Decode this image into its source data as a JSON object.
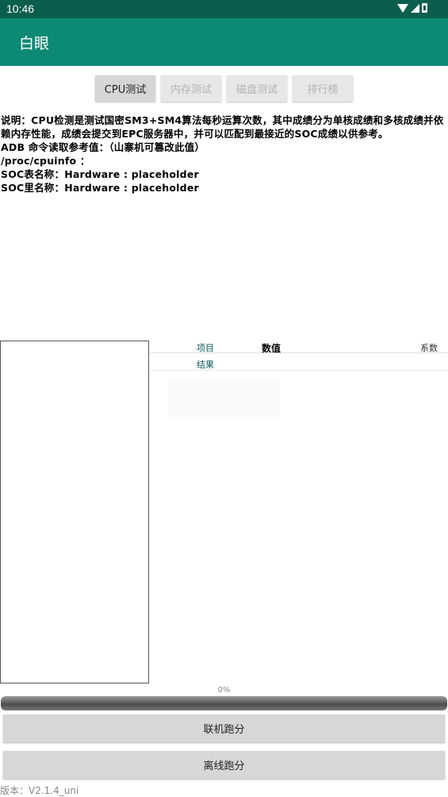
{
  "status_bar": {
    "time": "10:46"
  },
  "app_bar": {
    "title": "白眼"
  },
  "tabs": [
    {
      "label": "CPU测试",
      "active": true
    },
    {
      "label": "内存测试",
      "active": false
    },
    {
      "label": "磁盘测试",
      "active": false
    },
    {
      "label": "排行榜",
      "active": false
    }
  ],
  "description": {
    "intro": "说明：CPU检测是测试国密SM3+SM4算法每秒运算次数，其中成绩分为单核成绩和多核成绩并依赖内存性能，成绩会提交到EPC服务器中，并可以匹配到最接近的SOC成绩以供参考。",
    "adb": "ADB 命令读取参考值：（山寨机可篡改此值）",
    "path": "/proc/cpuinfo ：",
    "soc_table": "SOC表名称：Hardware : placeholder",
    "soc_inner": "SOC里名称：Hardware : placeholder"
  },
  "table": {
    "header_item": "项目",
    "header_value": "数值",
    "header_coef": "系数",
    "row_result": "结果"
  },
  "progress": {
    "label": "0%",
    "value": 0
  },
  "buttons": {
    "online": "联机跑分",
    "offline": "离线跑分"
  },
  "version": "版本：V2.1.4_uni",
  "colors": {
    "status_bar": "#0a5e4e",
    "app_bar": "#0d8a74"
  },
  "icons": [
    "wifi-icon",
    "signal-icon",
    "battery-icon"
  ]
}
